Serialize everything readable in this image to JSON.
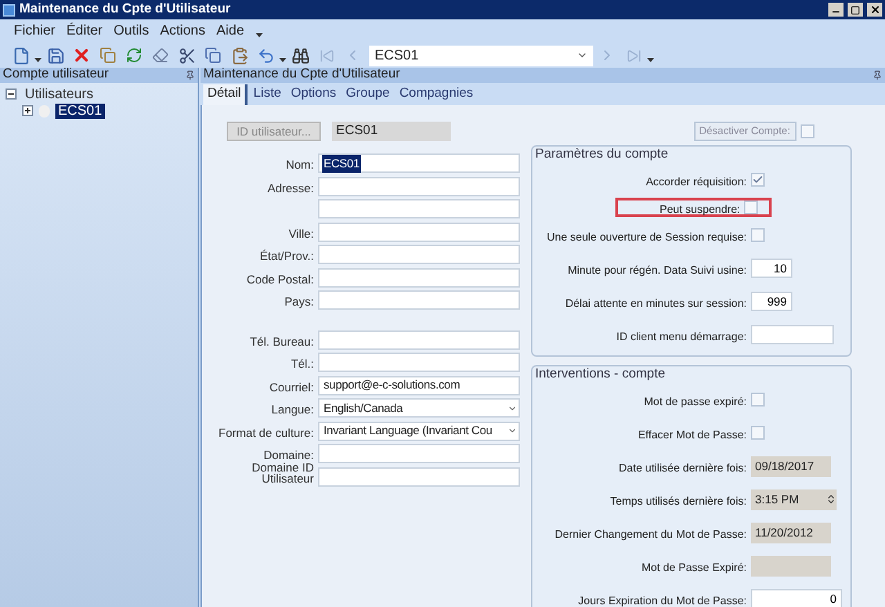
{
  "window": {
    "title": "Maintenance du Cpte d'Utilisateur"
  },
  "menu": [
    "Fichier",
    "Éditer",
    "Outils",
    "Actions",
    "Aide"
  ],
  "toolbar": {
    "record": "ECS01"
  },
  "side_panel": {
    "title": "Compte utilisateur",
    "tree": [
      {
        "label": "Utilisateurs",
        "expanded": true,
        "selected": false,
        "children": [
          {
            "label": "ECS01",
            "expanded": false,
            "selected": true
          }
        ]
      }
    ]
  },
  "main_panel": {
    "title": "Maintenance du Cpte d'Utilisateur"
  },
  "tabs": [
    {
      "label": "Détail",
      "selected": true
    },
    {
      "label": "Liste",
      "selected": false
    },
    {
      "label": "Options",
      "selected": false
    },
    {
      "label": "Groupe",
      "selected": false
    },
    {
      "label": "Compagnies",
      "selected": false
    }
  ],
  "user_id": {
    "button": "ID utilisateur...",
    "value": "ECS01"
  },
  "field_groups": [
    [
      {
        "label": "Nom:",
        "value": "ECS01",
        "kind": "text",
        "text_selected": true
      },
      {
        "label": "Adresse:",
        "kind": "text"
      },
      {
        "kind": "text"
      },
      {
        "label": "Ville:",
        "kind": "text"
      },
      {
        "label": "État/Prov.:",
        "kind": "text"
      },
      {
        "label": "Code Postal:",
        "kind": "text"
      },
      {
        "label": "Pays:",
        "kind": "text"
      }
    ],
    [
      {
        "label": "Tél. Bureau:",
        "kind": "text"
      },
      {
        "label": "Tél.:",
        "kind": "text"
      },
      {
        "label": "Courriel:",
        "value": "support@e-c-solutions.com",
        "kind": "text"
      },
      {
        "label": "Langue:",
        "value": "English/Canada",
        "kind": "combo"
      },
      {
        "label": "Format de culture:",
        "value": "Invariant Language (Invariant Cou",
        "kind": "combo"
      },
      {
        "label": "Domaine:",
        "kind": "text"
      },
      {
        "label": "Domaine ID Utilisateur",
        "kind": "text"
      }
    ]
  ],
  "deactivate": {
    "button": "Désactiver Compte:",
    "checked": false
  },
  "sections": [
    {
      "title": "Paramètres du compte",
      "rows": [
        {
          "label": "Accorder réquisition:",
          "kind": "checkbox",
          "checked": true
        },
        {
          "label": "Peut suspendre:",
          "kind": "checkbox",
          "checked": false,
          "highlighted": true
        },
        {
          "label": "Une seule ouverture de Session requise:",
          "kind": "checkbox",
          "checked": false
        },
        {
          "label": "Minute pour régén. Data Suivi usine:",
          "kind": "short",
          "value": "10"
        },
        {
          "label": "Délai attente en minutes sur session:",
          "kind": "short",
          "value": "999"
        },
        {
          "label": "ID client menu démarrage:",
          "kind": "text"
        }
      ]
    },
    {
      "title": "Interventions - compte",
      "rows": [
        {
          "label": "Mot de passe expiré:",
          "kind": "checkbox",
          "checked": false
        },
        {
          "label": "Effacer Mot de Passe:",
          "kind": "checkbox",
          "checked": false
        },
        {
          "label": "Date utilisée dernière fois:",
          "kind": "readonly",
          "value": "09/18/2017"
        },
        {
          "label": "Temps utilisés dernière fois:",
          "kind": "time",
          "value": "3:15 PM"
        },
        {
          "label": "Dernier Changement du Mot de Passe:",
          "kind": "readonly",
          "value": "11/20/2012"
        },
        {
          "label": "Mot de Passe Expiré:",
          "kind": "readonly"
        },
        {
          "label": "Jours Expiration du Mot de Passe:",
          "kind": "number",
          "value": "0"
        }
      ]
    }
  ]
}
